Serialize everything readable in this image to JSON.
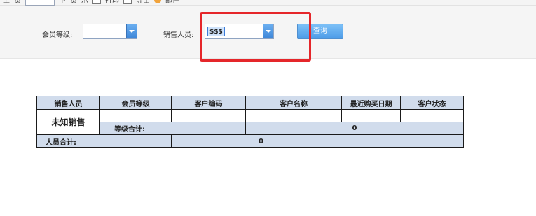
{
  "toolbar": {
    "items": [
      "上",
      "页",
      "下",
      "页",
      "示",
      "打印",
      "导出",
      "邮件"
    ]
  },
  "filters": {
    "member_level_label": "会员等级:",
    "member_level_value": "",
    "sales_person_label": "销售人员:",
    "sales_person_value": "$$$",
    "query_button": "查询"
  },
  "table": {
    "headers": [
      "销售人员",
      "会员等级",
      "客户编码",
      "客户名称",
      "最近购买日期",
      "客户状态"
    ],
    "rep_name": "未知销售",
    "level_subtotal_label": "等级合计:",
    "level_subtotal_value": "0",
    "rep_total_label": "人员合计:",
    "rep_total_value": "0"
  },
  "colors": {
    "highlight": "#e5262a",
    "header_bg": "#d1dcec",
    "button_blue": "#4d9ce8"
  }
}
